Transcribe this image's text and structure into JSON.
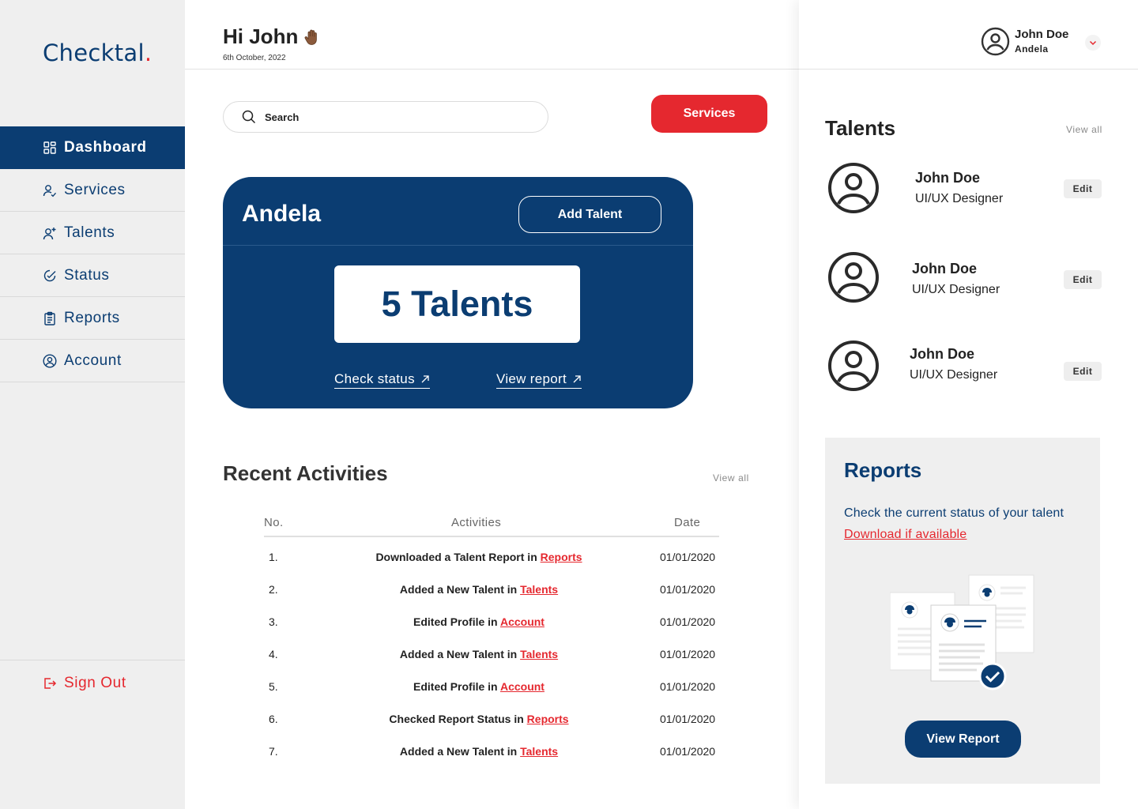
{
  "brand": {
    "name": "Checktal",
    "dot": ".",
    "accent": "#e5282f",
    "primary": "#0b3d72"
  },
  "sidebar": {
    "items": [
      {
        "label": "Dashboard",
        "icon": "dashboard-icon",
        "active": true
      },
      {
        "label": "Services",
        "icon": "services-icon"
      },
      {
        "label": "Talents",
        "icon": "add-user-icon"
      },
      {
        "label": "Status",
        "icon": "status-icon"
      },
      {
        "label": "Reports",
        "icon": "clipboard-icon"
      },
      {
        "label": "Account",
        "icon": "account-icon"
      }
    ],
    "signout": "Sign Out"
  },
  "header": {
    "greeting": "Hi John",
    "date": "6th October, 2022"
  },
  "search": {
    "placeholder": "Search",
    "value": ""
  },
  "services_button": "Services",
  "company_card": {
    "name": "Andela",
    "add_talent": "Add Talent",
    "count_label": "5 Talents",
    "check_status": "Check status",
    "view_report": "View report"
  },
  "recent_activities": {
    "title": "Recent Activities",
    "view_all": "View all",
    "columns": [
      "No.",
      "Activities",
      "Date"
    ],
    "rows": [
      {
        "no": "1.",
        "text": "Downloaded a Talent Report in ",
        "link": "Reports",
        "date": "01/01/2020"
      },
      {
        "no": "2.",
        "text": "Added a New Talent in ",
        "link": "Talents",
        "date": "01/01/2020"
      },
      {
        "no": "3.",
        "text": "Edited Profile in ",
        "link": "Account",
        "date": "01/01/2020"
      },
      {
        "no": "4.",
        "text": "Added a New Talent in ",
        "link": "Talents",
        "date": "01/01/2020"
      },
      {
        "no": "5.",
        "text": "Edited Profile in ",
        "link": "Account",
        "date": "01/01/2020"
      },
      {
        "no": "6.",
        "text": "Checked Report Status in ",
        "link": "Reports",
        "date": "01/01/2020"
      },
      {
        "no": "7.",
        "text": "Added a New Talent in ",
        "link": "Talents",
        "date": "01/01/2020"
      }
    ]
  },
  "user": {
    "name": "John Doe",
    "org": "Andela"
  },
  "talents": {
    "title": "Talents",
    "view_all": "View all",
    "items": [
      {
        "name": "John Doe",
        "role": "UI/UX Designer",
        "edit": "Edit"
      },
      {
        "name": "John Doe",
        "role": "UI/UX Designer",
        "edit": "Edit"
      },
      {
        "name": "John Doe",
        "role": "UI/UX Designer",
        "edit": "Edit"
      }
    ]
  },
  "reports": {
    "title": "Reports",
    "description": "Check the current status of your talent",
    "download": "Download if available",
    "button": "View Report"
  }
}
